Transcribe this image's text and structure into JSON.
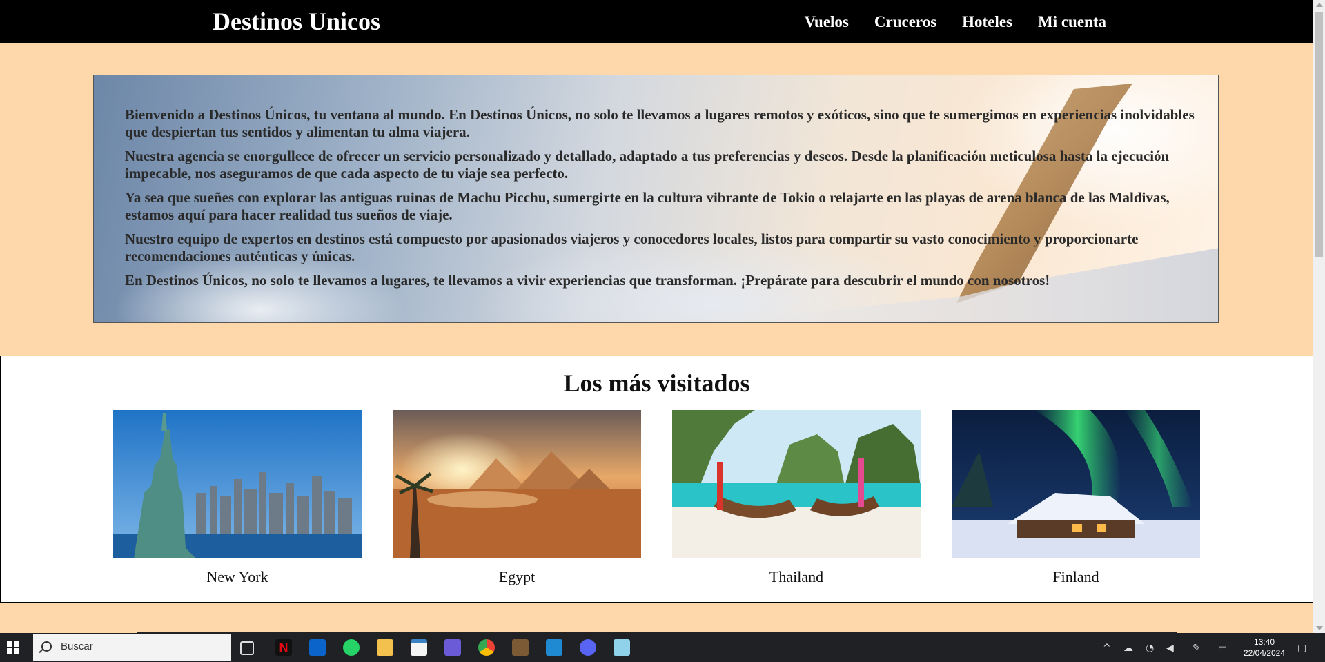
{
  "nav": {
    "brand": "Destinos Unicos",
    "links": [
      "Vuelos",
      "Cruceros",
      "Hoteles",
      "Mi cuenta"
    ]
  },
  "hero": {
    "paragraphs": [
      "Bienvenido a Destinos Únicos, tu ventana al mundo. En Destinos Únicos, no solo te llevamos a lugares remotos y exóticos, sino que te sumergimos en experiencias inolvidables que despiertan tus sentidos y alimentan tu alma viajera.",
      "Nuestra agencia se enorgullece de ofrecer un servicio personalizado y detallado, adaptado a tus preferencias y deseos. Desde la planificación meticulosa hasta la ejecución impecable, nos aseguramos de que cada aspecto de tu viaje sea perfecto.",
      "Ya sea que sueñes con explorar las antiguas ruinas de Machu Picchu, sumergirte en la cultura vibrante de Tokio o relajarte en las playas de arena blanca de las Maldivas, estamos aquí para hacer realidad tus sueños de viaje.",
      "Nuestro equipo de expertos en destinos está compuesto por apasionados viajeros y conocedores locales, listos para compartir su vasto conocimiento y proporcionarte recomendaciones auténticas y únicas.",
      "En Destinos Únicos, no solo te llevamos a lugares, te llevamos a vivir experiencias que transforman. ¡Prepárate para descubrir el mundo con nosotros!"
    ]
  },
  "visited": {
    "title": "Los más visitados",
    "destinations": [
      {
        "name": "New York",
        "image": "statue-of-liberty-skyline"
      },
      {
        "name": "Egypt",
        "image": "pyramids-desert-sunset"
      },
      {
        "name": "Thailand",
        "image": "longtail-boats-beach"
      },
      {
        "name": "Finland",
        "image": "aurora-snowy-cabin"
      }
    ]
  },
  "taskbar": {
    "search_placeholder": "Buscar",
    "time": "13:40",
    "date": "22/04/2024",
    "apps": [
      "task-view-icon",
      "netflix-icon",
      "outlook-icon",
      "whatsapp-icon",
      "file-explorer-icon",
      "calendar-app-icon",
      "video-app-icon",
      "chrome-icon",
      "minecraft-icon",
      "vscode-icon",
      "discord-icon",
      "notepad-icon"
    ]
  }
}
